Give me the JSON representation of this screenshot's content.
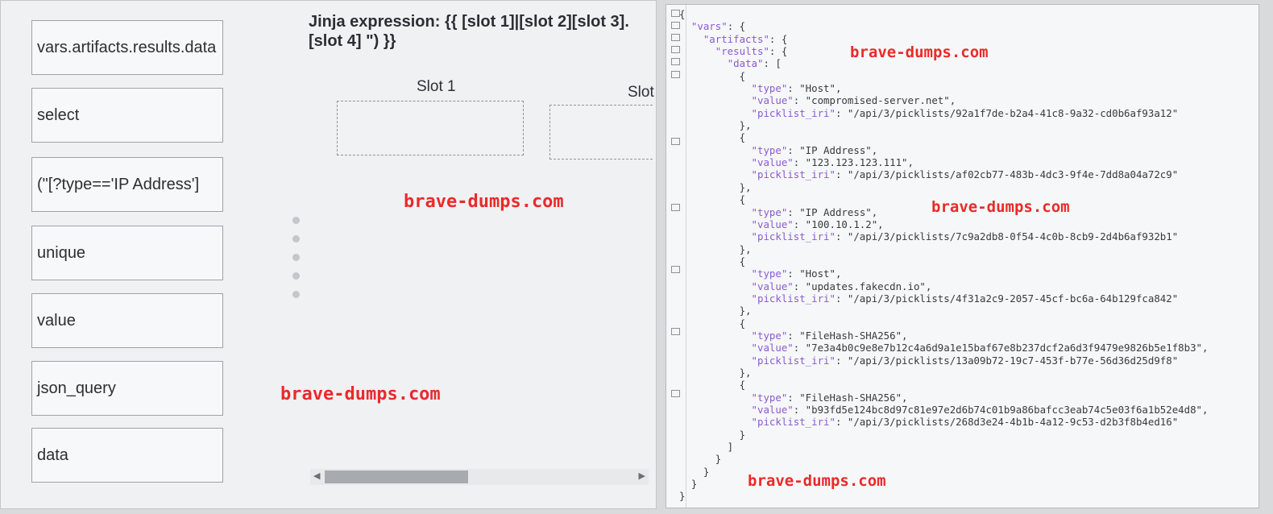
{
  "question": {
    "expression": "Jinja expression: {{ [slot 1]|[slot 2][slot 3].[slot 4] \") }}"
  },
  "options": [
    "vars.artifacts.results.data",
    "select",
    "(\"[?type=='IP Address']",
    "unique",
    "value",
    "json_query",
    "data"
  ],
  "slots": {
    "slot1_label": "Slot 1",
    "slot2_label": "Slot"
  },
  "watermark": "brave-dumps.com",
  "json_view": {
    "lines": [
      "{",
      "  \"vars\": {",
      "    \"artifacts\": {",
      "      \"results\": {",
      "        \"data\": [",
      "          {",
      "            \"type\": \"Host\",",
      "            \"value\": \"compromised-server.net\",",
      "            \"picklist_iri\": \"/api/3/picklists/92a1f7de-b2a4-41c8-9a32-cd0b6af93a12\"",
      "          },",
      "          {",
      "            \"type\": \"IP Address\",",
      "            \"value\": \"123.123.123.111\",",
      "            \"picklist_iri\": \"/api/3/picklists/af02cb77-483b-4dc3-9f4e-7dd8a04a72c9\"",
      "          },",
      "          {",
      "            \"type\": \"IP Address\",",
      "            \"value\": \"100.10.1.2\",",
      "            \"picklist_iri\": \"/api/3/picklists/7c9a2db8-0f54-4c0b-8cb9-2d4b6af932b1\"",
      "          },",
      "          {",
      "            \"type\": \"Host\",",
      "            \"value\": \"updates.fakecdn.io\",",
      "            \"picklist_iri\": \"/api/3/picklists/4f31a2c9-2057-45cf-bc6a-64b129fca842\"",
      "          },",
      "          {",
      "            \"type\": \"FileHash-SHA256\",",
      "            \"value\": \"7e3a4b0c9e8e7b12c4a6d9a1e15baf67e8b237dcf2a6d3f9479e9826b5e1f8b3\",",
      "            \"picklist_iri\": \"/api/3/picklists/13a09b72-19c7-453f-b77e-56d36d25d9f8\"",
      "          },",
      "          {",
      "            \"type\": \"FileHash-SHA256\",",
      "            \"value\": \"b93fd5e124bc8d97c81e97e2d6b74c01b9a86bafcc3eab74c5e03f6a1b52e4d8\",",
      "            \"picklist_iri\": \"/api/3/picklists/268d3e24-4b1b-4a12-9c53-d2b3f8b4ed16\"",
      "          }",
      "        ]",
      "      }",
      "    }",
      "  }",
      "}"
    ]
  }
}
